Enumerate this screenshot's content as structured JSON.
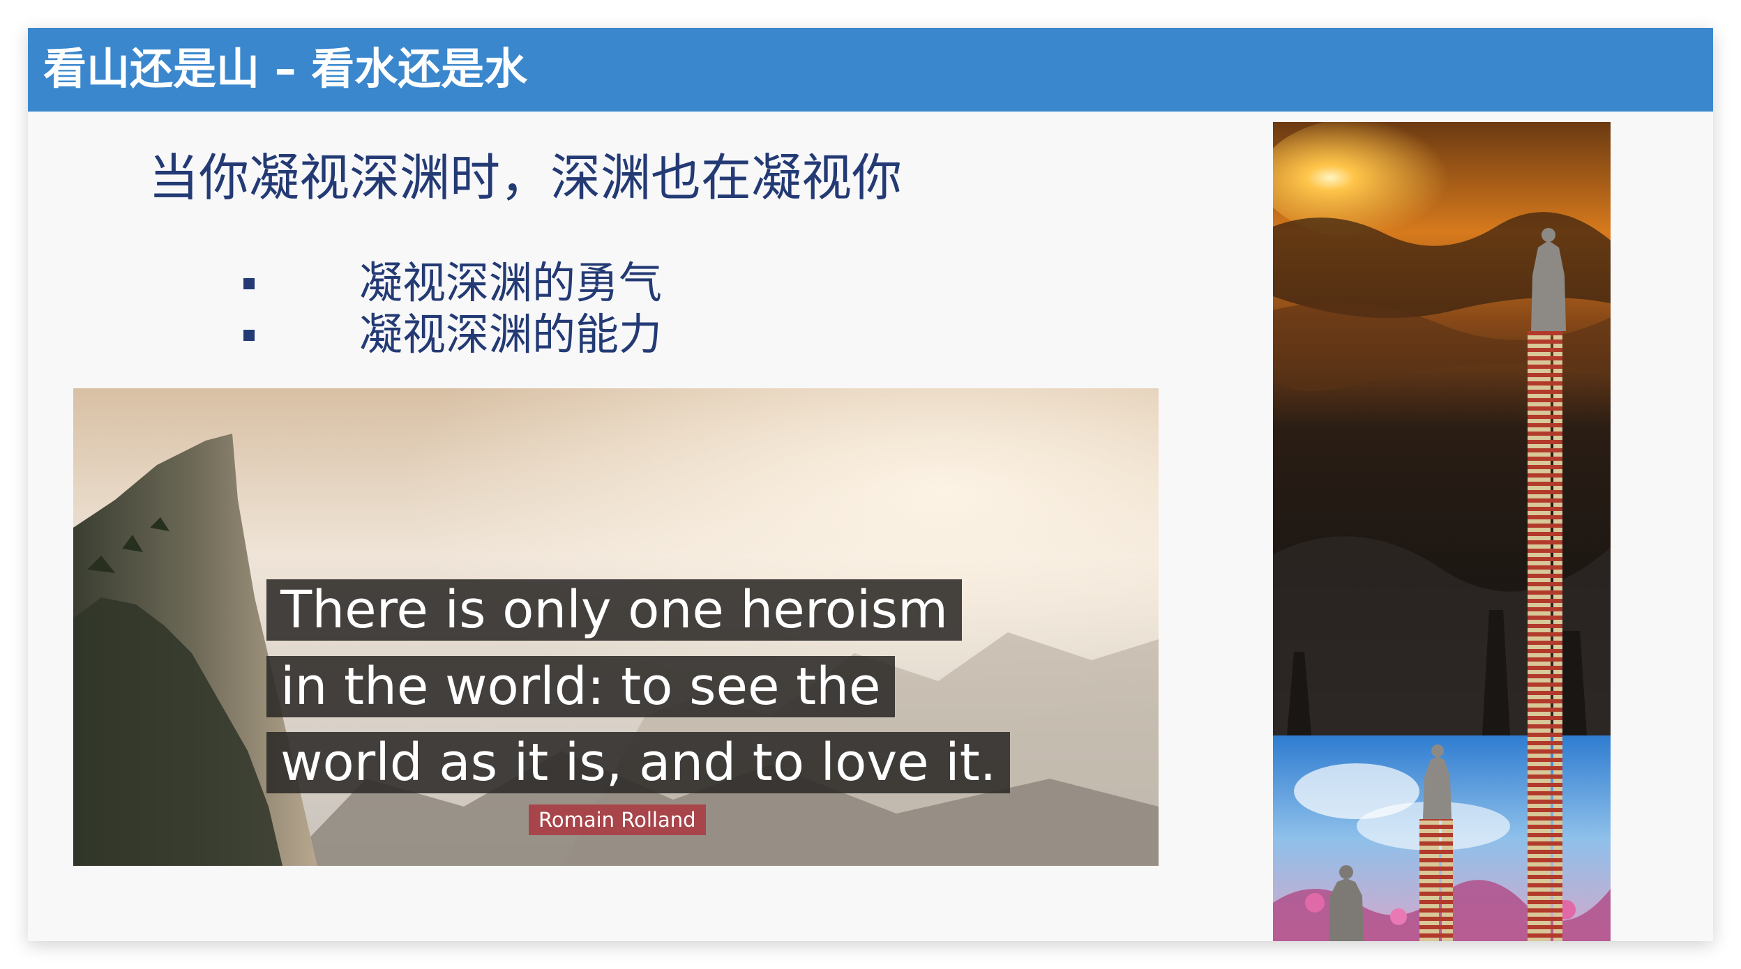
{
  "slide": {
    "title": "看山还是山 – 看水还是水",
    "heading": "当你凝视深渊时，深渊也在凝视你",
    "bullets": [
      {
        "text": "凝视深渊的勇气"
      },
      {
        "text": "凝视深渊的能力"
      }
    ],
    "quote_image": {
      "lines": [
        "There is only one heroism",
        "in the world: to see the",
        "world as it is, and to love it."
      ],
      "author": "Romain Rolland"
    }
  },
  "colors": {
    "title_bar": "#3a87cd",
    "title_text": "#ffffff",
    "body_text": "#233a74",
    "quote_box": "#2c2a28",
    "author_badge": "#a7454a"
  }
}
